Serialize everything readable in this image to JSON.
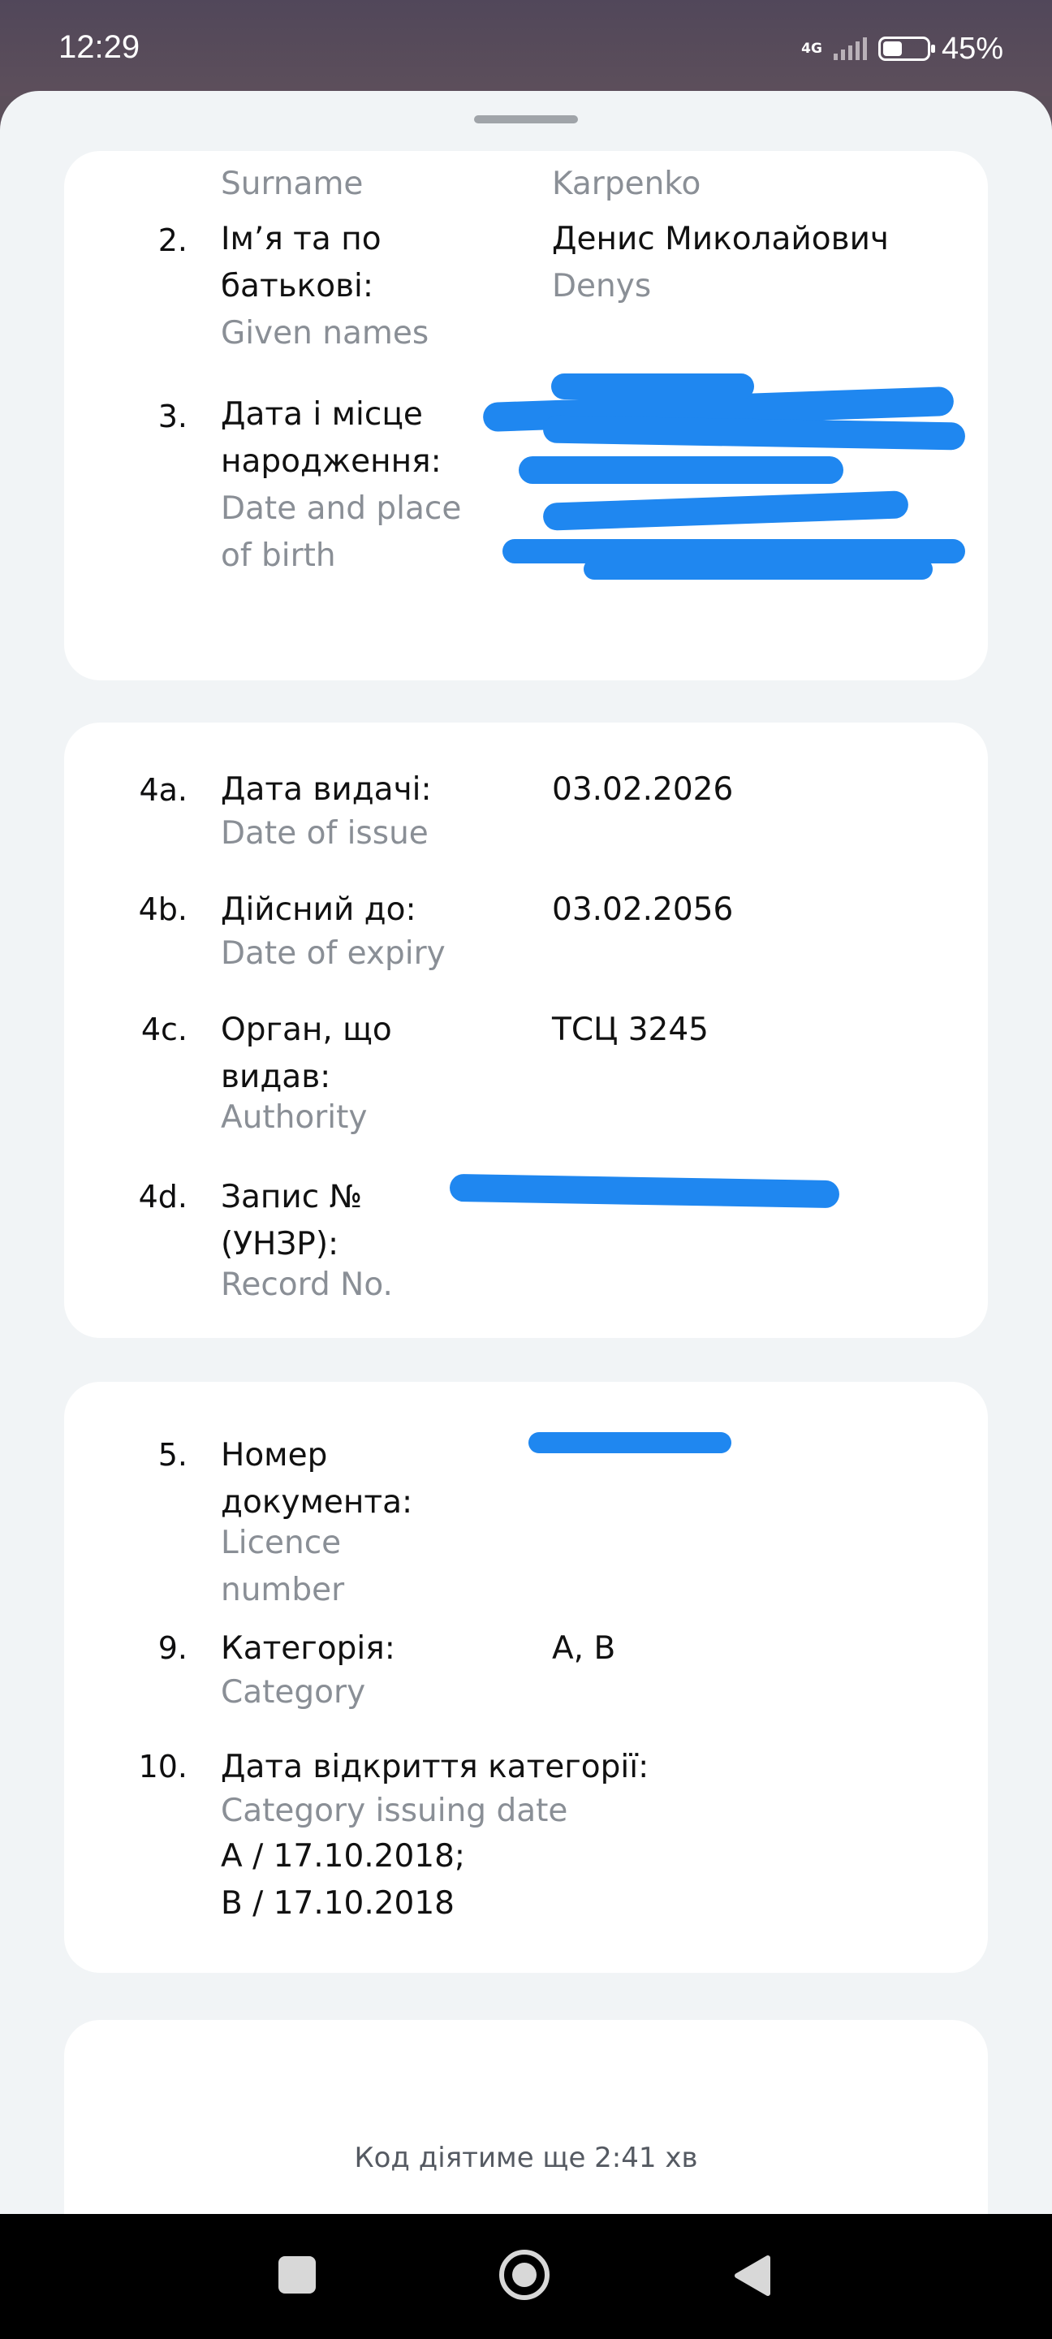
{
  "status_bar": {
    "time": "12:29",
    "network": "4G",
    "battery": "45%",
    "battery_level": 0.45
  },
  "card1": {
    "rows": [
      {
        "number": "",
        "label": "",
        "label_en": "Surname",
        "value": "",
        "value_en": "Karpenko"
      },
      {
        "number": "2.",
        "label": "Імʼя та по батькові:",
        "label_en": "Given names",
        "value": "Денис Миколайович",
        "value_en": "Denys"
      },
      {
        "number": "3.",
        "label": "Дата і місце народження:",
        "label_en": "Date and place of birth",
        "value": "",
        "value_en": ""
      }
    ]
  },
  "card2": {
    "rows": [
      {
        "number": "4a.",
        "label": "Дата видачі:",
        "label_en": "Date of issue",
        "value": "03.02.2026"
      },
      {
        "number": "4b.",
        "label": "Дійсний до:",
        "label_en": "Date of expiry",
        "value": "03.02.2056"
      },
      {
        "number": "4c.",
        "label": "Орган, що видав:",
        "label_en": "Authority",
        "value": "ТСЦ 3245"
      },
      {
        "number": "4d.",
        "label": "Запис № (УНЗР):",
        "label_en": "Record No.",
        "value": ""
      }
    ]
  },
  "card3": {
    "rows": [
      {
        "number": "5.",
        "label": "Номер документа:",
        "label_en": "Licence number",
        "value": ""
      },
      {
        "number": "9.",
        "label": "Категорія:",
        "label_en": "Category",
        "value": "A, B"
      },
      {
        "number": "10.",
        "label": "Дата відкриття категорії:",
        "label_en": "Category issuing date",
        "value": ""
      }
    ],
    "category_dates": [
      "A / 17.10.2018;",
      "B / 17.10.2018"
    ]
  },
  "card4": {
    "code_timer_text": "Код діятиме ще  2:41  хв"
  },
  "nav": {
    "recents": "square-icon",
    "home": "circle-icon",
    "back": "triangle-icon"
  }
}
